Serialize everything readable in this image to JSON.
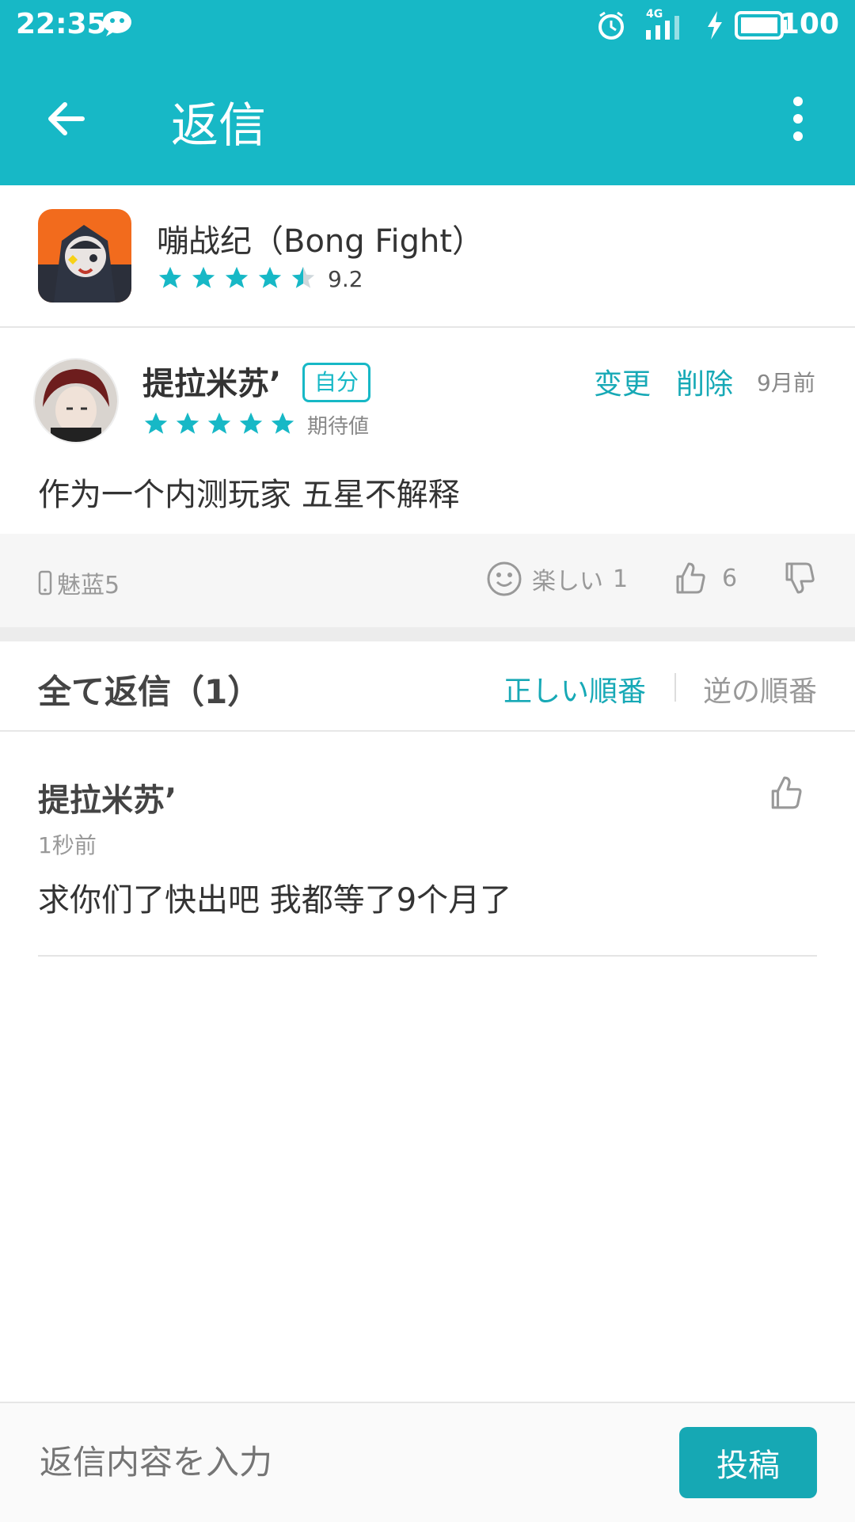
{
  "status_bar": {
    "time": "22:35",
    "network": "4G",
    "battery": "100",
    "icons": [
      "wechat-icon",
      "alarm-icon",
      "signal-icon",
      "charging-icon",
      "battery-icon"
    ]
  },
  "app_bar": {
    "title": "返信",
    "back_icon": "arrow-left-icon",
    "menu_icon": "more-vertical-icon"
  },
  "game": {
    "title": "嘣战纪（Bong Fight）",
    "rating": "9.2",
    "stars_filled": 4.5
  },
  "review": {
    "user": "提拉米苏’",
    "badge": "自分",
    "change_label": "变更",
    "delete_label": "削除",
    "time": "9月前",
    "stars_filled": 5,
    "expect_label": "期待値",
    "text": "作为一个内测玩家 五星不解释",
    "device": "魅蓝5",
    "fun_label": "楽しい",
    "fun_count": "1",
    "like_count": "6"
  },
  "replies": {
    "title": "全て返信（1）",
    "order_correct": "正しい順番",
    "order_reverse": "逆の順番",
    "items": [
      {
        "user": "提拉米苏’",
        "time": "1秒前",
        "text": "求你们了快出吧 我都等了9个月了"
      }
    ]
  },
  "bottom": {
    "input_placeholder": "返信内容を入力",
    "post_label": "投稿"
  },
  "colors": {
    "accent": "#17b8c6",
    "accent_text": "#17a9b6",
    "muted": "#999999"
  }
}
